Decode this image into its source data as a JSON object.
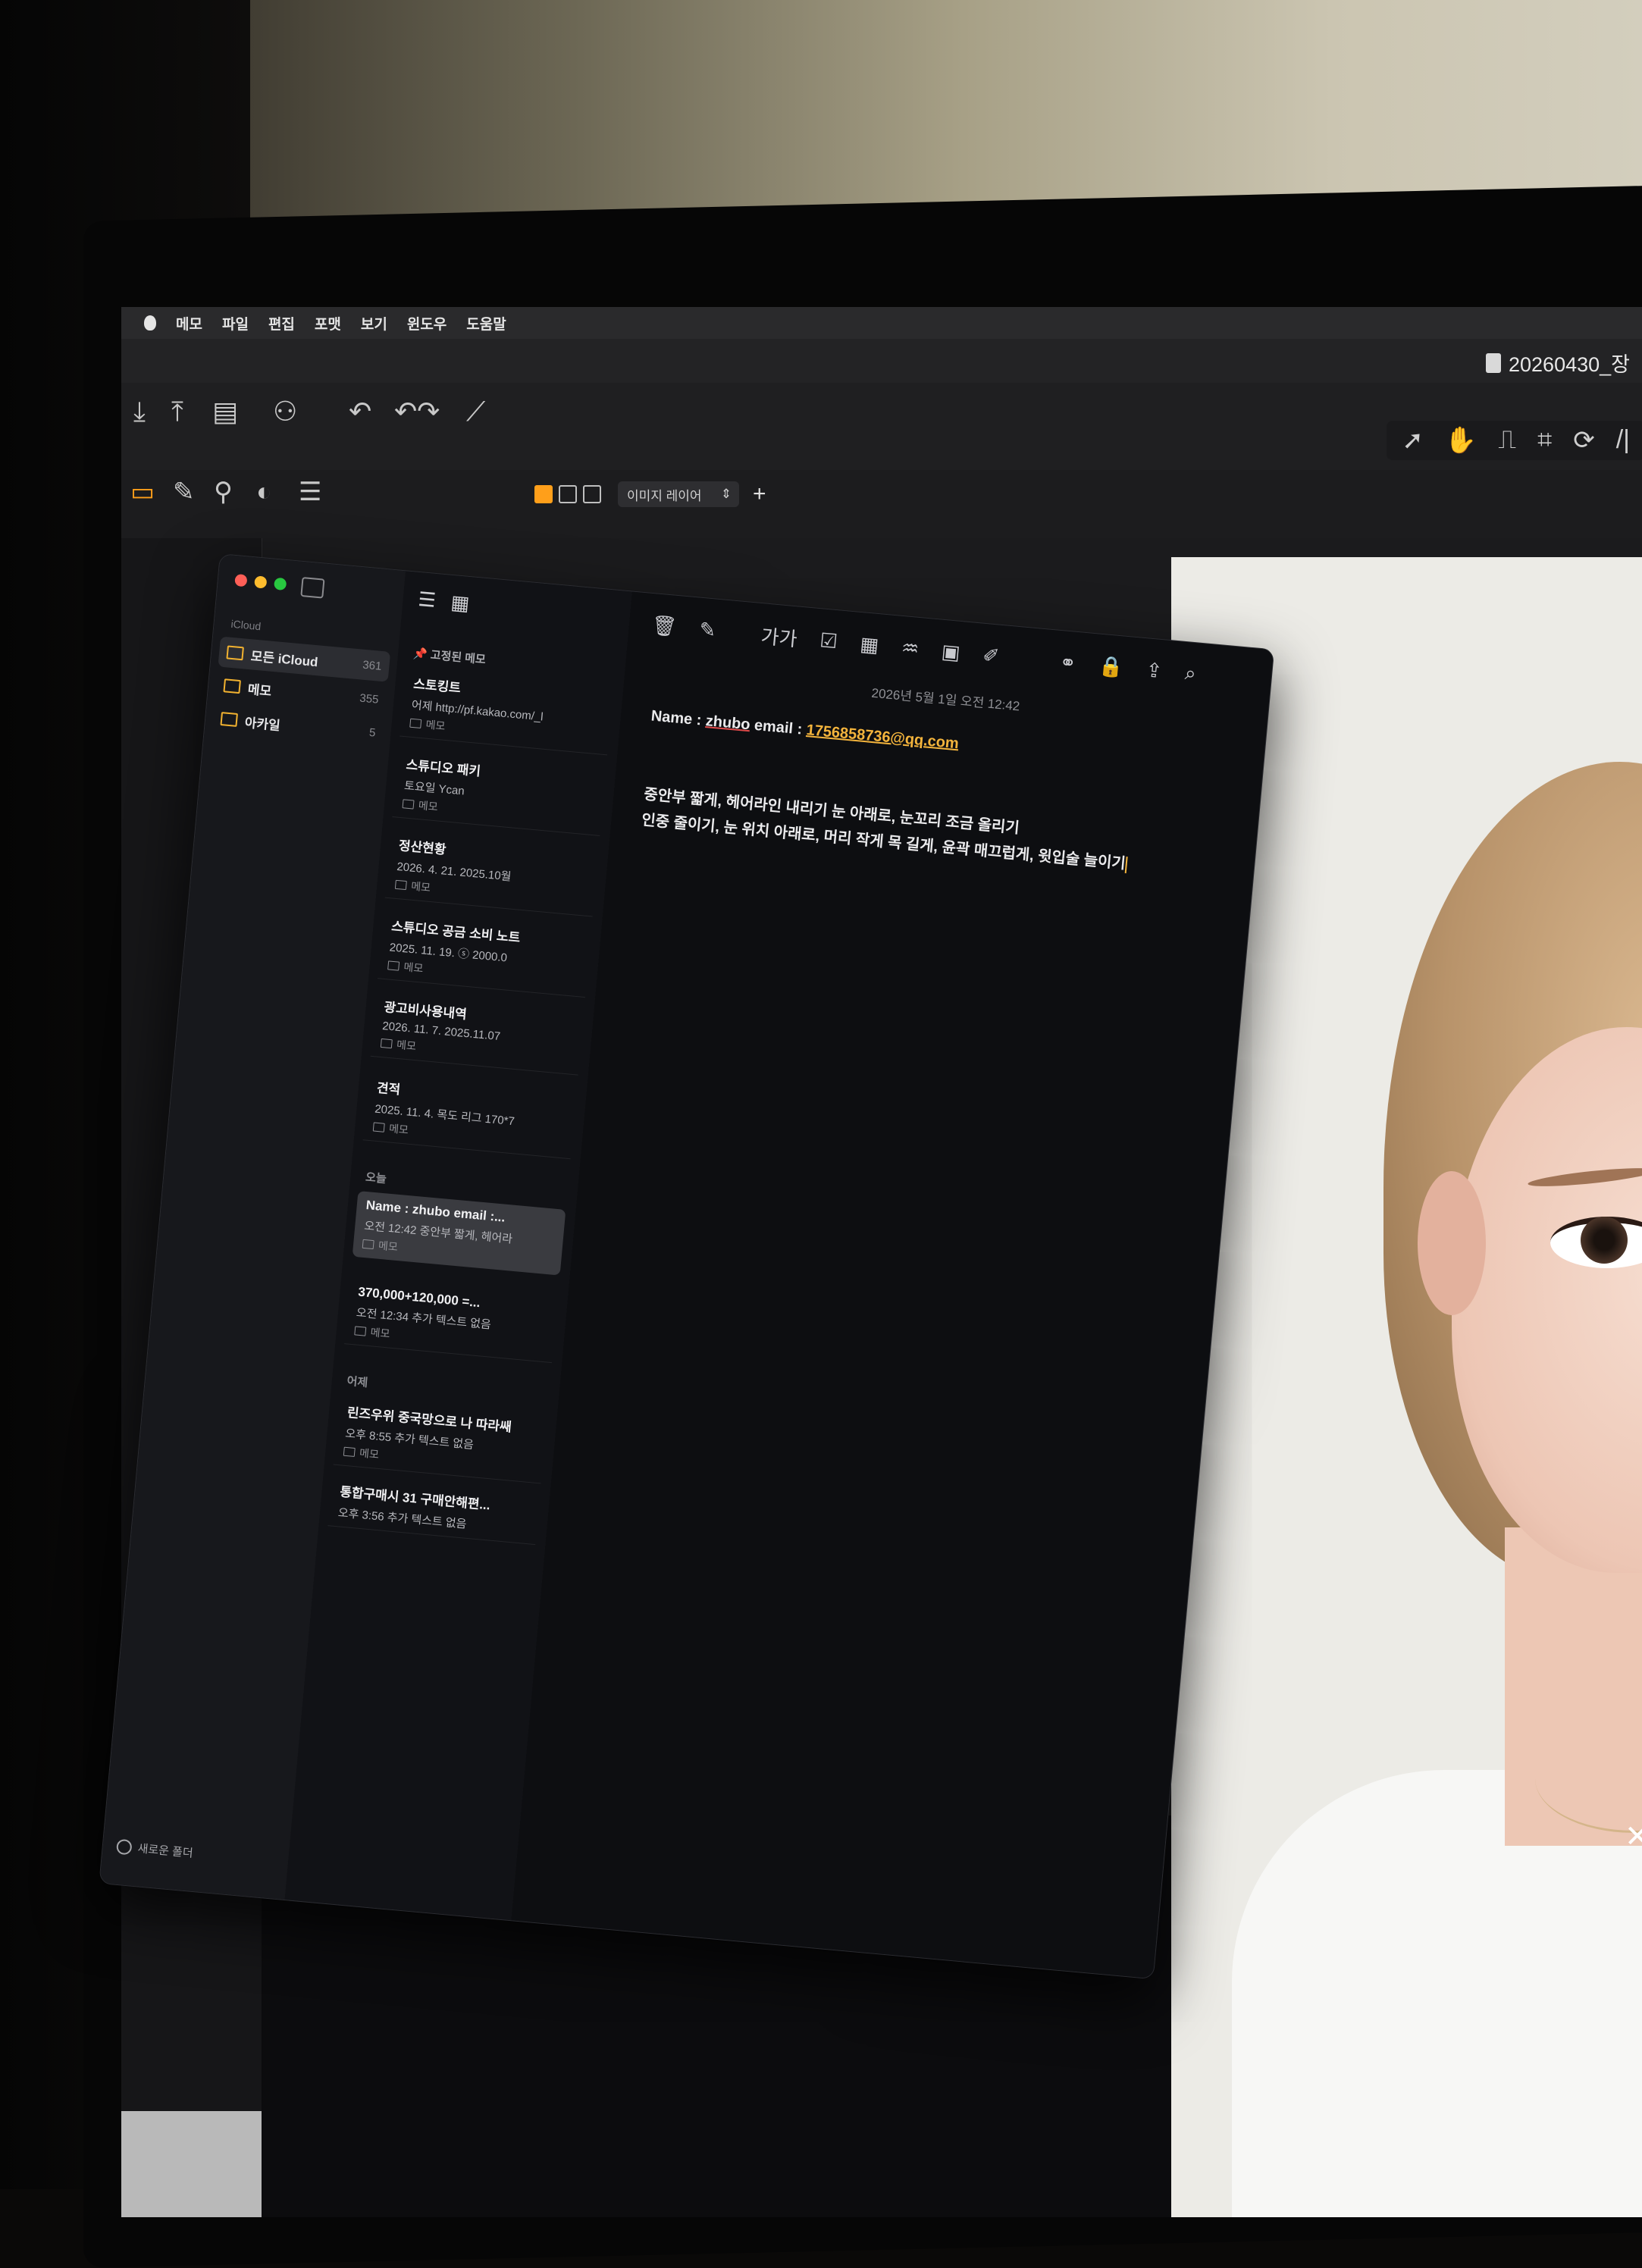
{
  "menubar": {
    "items": [
      "메모",
      "파일",
      "편집",
      "포맷",
      "보기",
      "윈도우",
      "도움말"
    ]
  },
  "editor_window": {
    "filename": "20260430_장"
  },
  "toolbar1": {
    "items": [
      {
        "icon": "download-icon",
        "glyph": "⤓",
        "label": ""
      },
      {
        "icon": "upload-icon",
        "glyph": "⤒",
        "label": ""
      },
      {
        "icon": "document-icon",
        "glyph": "▤",
        "label": ""
      },
      {
        "icon": "users-icon",
        "glyph": "⚇",
        "label": ""
      },
      {
        "icon": "undo-icon",
        "glyph": "↶",
        "label": ""
      },
      {
        "icon": "undo-redo-icon",
        "glyph": "↶↷",
        "label": ""
      },
      {
        "icon": "magic-wand-icon",
        "glyph": "⟋",
        "label": ""
      }
    ]
  },
  "right_tools": [
    {
      "icon": "select-arrow-icon",
      "glyph": "➚"
    },
    {
      "icon": "hand-icon",
      "glyph": "✋"
    },
    {
      "icon": "stamp-icon",
      "glyph": "⎍"
    },
    {
      "icon": "crop-icon",
      "glyph": "⌗"
    },
    {
      "icon": "rotate-icon",
      "glyph": "⟳"
    },
    {
      "icon": "ruler-icon",
      "glyph": "/|"
    }
  ],
  "toolbar2": {
    "items": [
      {
        "icon": "folder-icon",
        "glyph": "▭",
        "label": ""
      },
      {
        "icon": "edit-icon",
        "glyph": "✎",
        "label": ""
      },
      {
        "icon": "pin-icon",
        "glyph": "⚲",
        "label": ""
      },
      {
        "icon": "color-icon",
        "glyph": "◐",
        "label": ""
      },
      {
        "icon": "sliders-icon",
        "glyph": "☰",
        "label": ""
      }
    ]
  },
  "layer_select": {
    "value": "이미지 레이어"
  },
  "notes": {
    "sidebar": {
      "section": "iCloud",
      "folders": [
        {
          "name": "모든 iCloud",
          "count": "361",
          "selected": true
        },
        {
          "name": "메모",
          "count": "355",
          "selected": false
        },
        {
          "name": "아카일",
          "count": "5",
          "selected": false
        }
      ],
      "new_folder": "새로운 폴더"
    },
    "list": {
      "pinned_label": "고정된 메모",
      "pinned": [
        {
          "title": "스토킹트",
          "meta": "어제  http://pf.kakao.com/_l",
          "folder": "메모"
        },
        {
          "title": "스튜디오 패키",
          "meta": "토요일  Ycan",
          "folder": "메모"
        },
        {
          "title": "정산현황",
          "meta": "2026. 4. 21.  2025.10월",
          "folder": "메모"
        },
        {
          "title": "스튜디오 공금 소비 노트",
          "meta": "2025. 11. 19.  ⓢ 2000.0",
          "folder": "메모"
        },
        {
          "title": "광고비사용내역",
          "meta": "2026. 11. 7.  2025.11.07",
          "folder": "메모"
        },
        {
          "title": "견적",
          "meta": "2025. 11. 4.  목도 리그 170*7",
          "folder": "메모"
        }
      ],
      "today_label": "오늘",
      "today": [
        {
          "title": "Name : zhubo email :...",
          "meta": "오전 12:42  중안부 짧게, 헤어라",
          "folder": "메모",
          "selected": true
        },
        {
          "title": "370,000+120,000 =...",
          "meta": "오전 12:34  추가 텍스트 없음",
          "folder": "메모",
          "selected": false
        }
      ],
      "yesterday_label": "어제",
      "yesterday": [
        {
          "title": "린즈우위 중국망으로 나 따라쌔",
          "meta": "오후 8:55  추가 텍스트 없음",
          "folder": "메모"
        },
        {
          "title": "통합구매시 31 구매안해편...",
          "meta": "오후 3:56  추가 텍스트 없음",
          "folder": ""
        }
      ]
    },
    "editor": {
      "tools": [
        {
          "icon": "trash-icon",
          "glyph": "🗑"
        },
        {
          "icon": "compose-icon",
          "glyph": "✎"
        },
        {
          "icon": "text-format-icon",
          "glyph": "가가"
        },
        {
          "icon": "checklist-icon",
          "glyph": "☑"
        },
        {
          "icon": "table-icon",
          "glyph": "▦"
        },
        {
          "icon": "audio-icon",
          "glyph": "♒"
        },
        {
          "icon": "media-icon",
          "glyph": "▣"
        },
        {
          "icon": "markup-icon",
          "glyph": "✐"
        },
        {
          "icon": "collaborate-icon",
          "glyph": "⚭"
        },
        {
          "icon": "lock-icon",
          "glyph": "🔒"
        },
        {
          "icon": "share-icon",
          "glyph": "⇪"
        },
        {
          "icon": "search-icon",
          "glyph": "⌕"
        }
      ],
      "date": "2026년 5월 1일 오전 12:42",
      "line1_prefix": "Name : ",
      "line1_name": "zhubo",
      "line1_mid": " email : ",
      "email": "1756858736@qq.com",
      "body": [
        "중안부 짧게, 헤어라인 내리기 눈 아래로, 눈꼬리 조금 올리기",
        "인중 줄이기, 눈 위치 아래로, 머리 작게 목 길게, 윤곽 매끄럽게, 윗입술 늘이기"
      ]
    }
  },
  "colors": {
    "accent": "#f4b43c",
    "folder": "#f2b230",
    "close": "#ff5f57",
    "minimize": "#febc2e",
    "zoom": "#28c840"
  }
}
